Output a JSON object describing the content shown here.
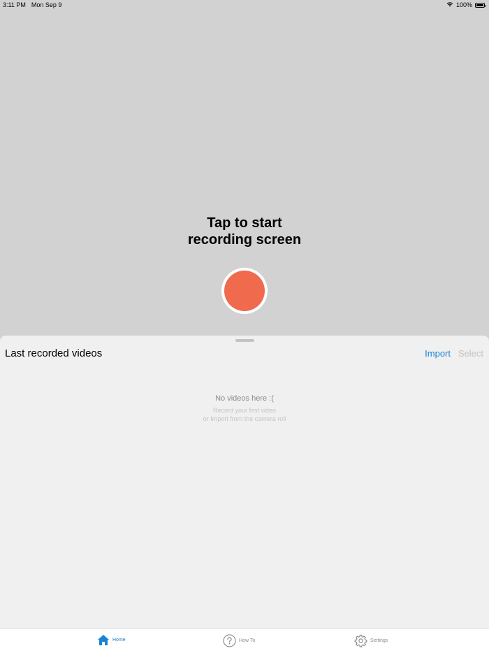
{
  "status_bar": {
    "time": "3:11 PM",
    "date": "Mon Sep 9",
    "wifi_icon": "wifi-icon",
    "battery_text": "100%",
    "battery_level": 1.0
  },
  "prompt": {
    "line1": "Tap to start",
    "line2": "recording screen"
  },
  "record_button": {
    "color": "#f06a4e"
  },
  "sheet": {
    "title": "Last recorded videos",
    "import_label": "Import",
    "select_label": "Select",
    "empty_title": "No videos here :(",
    "empty_line1": "Record your first video",
    "empty_line2": "or Import from the camera roll"
  },
  "tab_bar": {
    "tabs": [
      {
        "label": "Home",
        "icon": "home-icon",
        "selected": true
      },
      {
        "label": "How To",
        "icon": "question-icon",
        "selected": false
      },
      {
        "label": "Settings",
        "icon": "gear-icon",
        "selected": false
      }
    ]
  },
  "colors": {
    "accent": "#1a82d4",
    "record": "#f06a4e",
    "background": "#d2d2d2",
    "sheet": "#f0f0f0"
  }
}
